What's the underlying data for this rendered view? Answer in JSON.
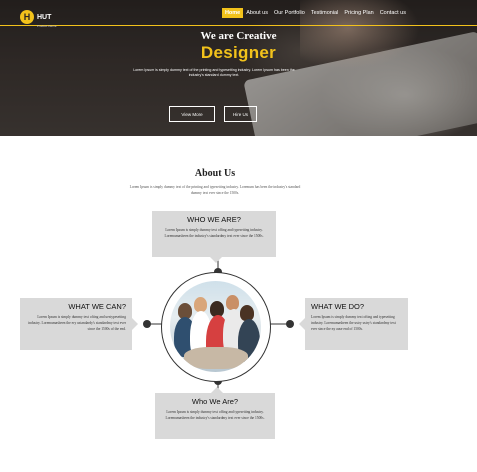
{
  "brand": {
    "name": "HUT",
    "tagline": "Product theme",
    "mark": "H"
  },
  "nav": {
    "items": [
      {
        "label": "Home",
        "active": true
      },
      {
        "label": "About us",
        "active": false
      },
      {
        "label": "Our Portfolio",
        "active": false
      },
      {
        "label": "Testimonial",
        "active": false
      },
      {
        "label": "Pricing Plan",
        "active": false
      },
      {
        "label": "Contact us",
        "active": false
      }
    ]
  },
  "hero": {
    "title": "We are Creative",
    "subtitle": "Designer",
    "description": "Lorem Ipsum is simply dummy text of the printing and typesetting industry. Lorem Ipsum has been the industry's standard dummy text.",
    "view_more_label": "View More",
    "hire_us_label": "Hire Us"
  },
  "about": {
    "title": "About Us",
    "description": "Lorem Ipsum is simply dummy text of the printing and typesetting industry. Loremum has been the industry's standard dummy text ever since the 1500s.",
    "cards": {
      "top": {
        "heading": "WHO WE ARE?",
        "text": "Lorem Ipsum is simply dummy text offing and typesetting industry. Loremumasbeen the industry's standardmy text ever since the 1500s."
      },
      "left": {
        "heading": "WHAT WE CAN?",
        "text": "Lorem Ipsum is simply dummy text ofting and uestypesetting industry. Loremumasbeen the ery ustandardy's standardmy text ever since the 1500s of the end."
      },
      "right": {
        "heading": "WHAT WE DO?",
        "text": "Lorem Ipsum is simply dummy text ofting and typesetting industry. Loremumasbeen the ustry ustry's standardmy text ever since the ny ause end of 1500s."
      },
      "bottom": {
        "heading": "Who We Are?",
        "text": "Lorem Ipsum is simply dummy text offing and typesetting industry. Loremumasbeen the industry's standardmy text ever since the 1500s."
      }
    }
  },
  "colors": {
    "accent": "#f2c21b",
    "card_bg": "#d9d9d9",
    "dark": "#333333"
  }
}
